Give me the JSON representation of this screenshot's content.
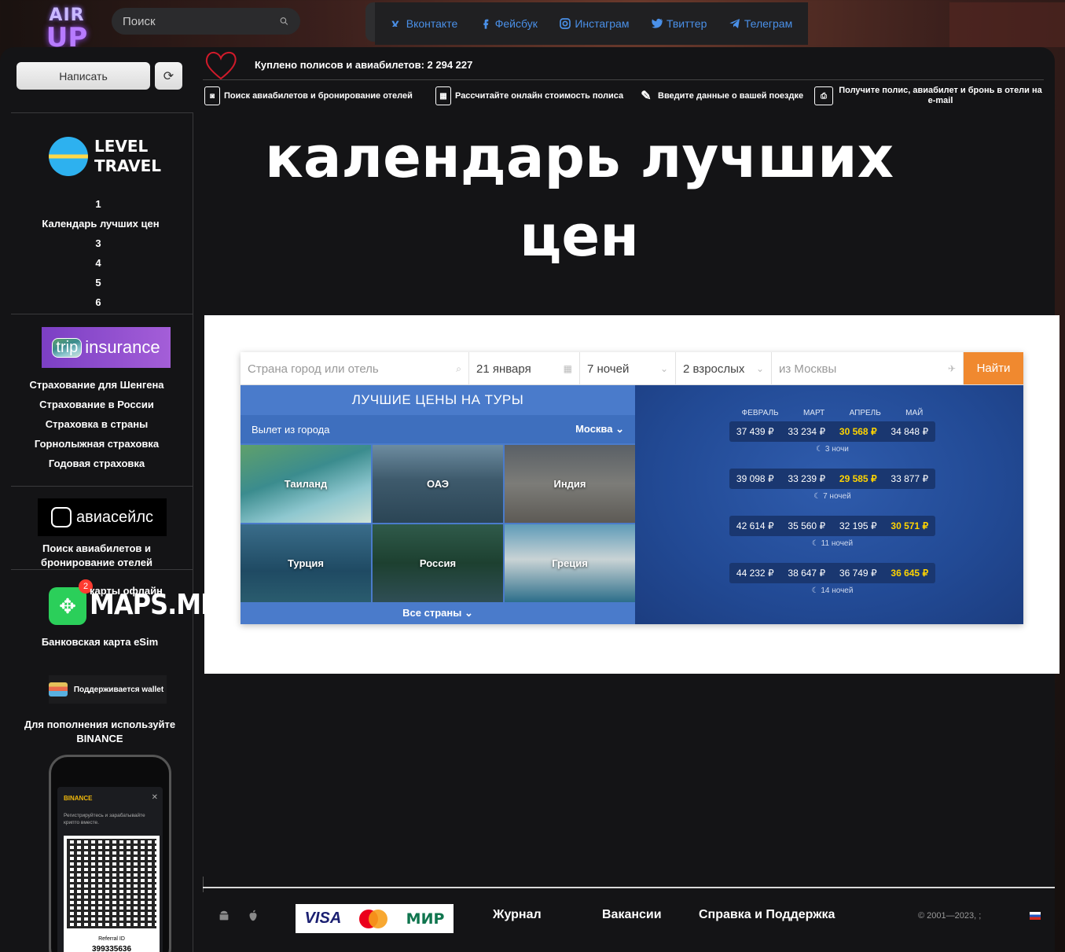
{
  "header": {
    "logo_line1": "AIR",
    "logo_line2": "UP",
    "search_placeholder": "Поиск",
    "social": [
      {
        "label": "Вконтакте",
        "icon": "vk-icon"
      },
      {
        "label": "Фейсбук",
        "icon": "facebook-icon"
      },
      {
        "label": "Инстаграм",
        "icon": "instagram-icon"
      },
      {
        "label": "Твиттер",
        "icon": "twitter-icon"
      },
      {
        "label": "Телеграм",
        "icon": "telegram-icon"
      }
    ]
  },
  "toolbar": {
    "write_label": "Написать",
    "refresh_icon": "refresh-icon"
  },
  "stats": {
    "bought_text": "Куплено полисов и авиабилетов: 2 294 227"
  },
  "steps": [
    {
      "label": "Поиск авиабилетов и бронирование отелей",
      "icon": "camera-icon"
    },
    {
      "label": "Рассчитайте онлайн стоимость полиса",
      "icon": "calculator-icon"
    },
    {
      "label": "Введите данные о вашей поездке",
      "icon": "edit-icon"
    },
    {
      "label": "Получите полис, авиабилет и бронь в отели на e-mail",
      "icon": "printer-icon"
    }
  ],
  "sidebar": {
    "level_travel": {
      "line1": "LEVEL",
      "line2": "TRAVEL"
    },
    "nav": [
      "1",
      "Календарь лучших цен",
      "3",
      "4",
      "5",
      "6"
    ],
    "insurance_logo": {
      "part1": "trip",
      "part2": "insurance"
    },
    "insurance_links": [
      "Страхование для Шенгена",
      "Страхование в России",
      "Страховка в страны",
      "Горнолыжная страховка",
      "Годовая страховка"
    ],
    "aviasales_logo": "авиасейлс",
    "aviasales_text": "Поиск авиабилетов и бронирование отелей",
    "maps_badge": "2",
    "maps_offline": "карты офлайн",
    "maps_logo": "MAPS.ME",
    "bank_text": "Банковская карта eSim",
    "wallet_text": "Поддерживается wallet",
    "binance_text": "Для пополнения используйте BINANCE",
    "phone": {
      "brand": "BINANCE",
      "close": "✕",
      "text": "Регистрируйтесь и зарабатывайте крипто вместе.",
      "ref_label": "Referral ID",
      "ref_id": "399335636"
    }
  },
  "main": {
    "headline_line1": "календарь лучших",
    "headline_line2": "цен"
  },
  "widget": {
    "fields": [
      {
        "value": "Страна город или отель",
        "placeholder": true
      },
      {
        "value": "21 января",
        "placeholder": false
      },
      {
        "value": "7 ночей",
        "placeholder": false
      },
      {
        "value": "2 взрослых",
        "placeholder": false
      },
      {
        "value": "из Москвы",
        "placeholder": true
      }
    ],
    "search_button": "Найти",
    "best_title": "ЛУЧШИЕ ЦЕНЫ НА ТУРЫ",
    "departure_label": "Вылет из города",
    "departure_city": "Москва",
    "destinations": [
      "Таиланд",
      "ОАЭ",
      "Индия",
      "Турция",
      "Россия",
      "Греция"
    ],
    "all_countries": "Все страны",
    "months": [
      "ФЕВРАЛЬ",
      "МАРТ",
      "АПРЕЛЬ",
      "МАЙ"
    ],
    "price_rows": [
      {
        "prices": [
          "37 439 ₽",
          "33 234 ₽",
          "30 568 ₽",
          "34 848 ₽"
        ],
        "best": 2,
        "nights": "3 ночи"
      },
      {
        "prices": [
          "39 098 ₽",
          "33 239 ₽",
          "29 585 ₽",
          "33 877 ₽"
        ],
        "best": 2,
        "nights": "7 ночей"
      },
      {
        "prices": [
          "42 614 ₽",
          "35 560 ₽",
          "32 195 ₽",
          "30 571 ₽"
        ],
        "best": 3,
        "nights": "11 ночей"
      },
      {
        "prices": [
          "44 232 ₽",
          "38 647 ₽",
          "36 749 ₽",
          "36 645 ₽"
        ],
        "best": 3,
        "nights": "14 ночей"
      }
    ],
    "colors": {
      "accent": "#f0892f",
      "highlight": "#ffd400",
      "panel_blue": "#4a7bcb"
    }
  },
  "footer": {
    "app_icons": [
      "android-icon",
      "apple-icon"
    ],
    "payments": {
      "visa": "VISA",
      "mastercard": "mastercard",
      "mir": "МИР"
    },
    "links": [
      "Журнал",
      "Вакансии",
      "Справка и Поддержка"
    ],
    "copyright": "© 2001—2023, ;",
    "language_flag": "ru-flag-icon"
  }
}
